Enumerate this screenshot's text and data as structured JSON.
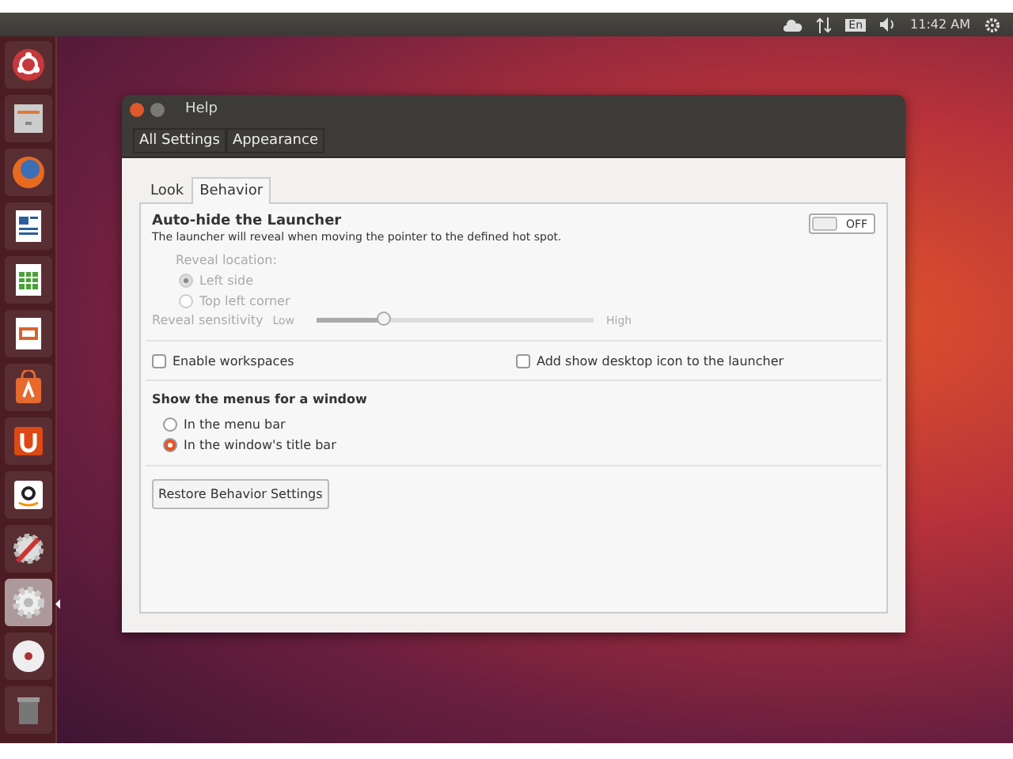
{
  "top_panel": {
    "keyboard": "En",
    "clock": "11:42 AM"
  },
  "launcher": [
    {
      "kind": "dash",
      "selected": false
    },
    {
      "kind": "files",
      "selected": false
    },
    {
      "kind": "browser",
      "selected": false
    },
    {
      "kind": "writer",
      "selected": false
    },
    {
      "kind": "calc",
      "selected": false
    },
    {
      "kind": "impress",
      "selected": false
    },
    {
      "kind": "store",
      "selected": false
    },
    {
      "kind": "ubuntu-one",
      "selected": false
    },
    {
      "kind": "amazon",
      "selected": false
    },
    {
      "kind": "tools",
      "selected": false
    },
    {
      "kind": "settings",
      "selected": true
    },
    {
      "kind": "disc",
      "selected": false
    },
    {
      "kind": "trash",
      "selected": false
    }
  ],
  "window": {
    "title": "Help",
    "toolbar": [
      "All Settings",
      "Appearance"
    ],
    "tabs": [
      {
        "label": "Look",
        "selected": false
      },
      {
        "label": "Behavior",
        "selected": true
      }
    ],
    "autohide": {
      "title": "Auto-hide the Launcher",
      "description": "The launcher will reveal when moving the pointer to the defined hot spot.",
      "switch": {
        "on": false,
        "label": "OFF"
      },
      "reveal_location": {
        "label": "Reveal location:",
        "disabled": true,
        "options": [
          {
            "label": "Left side",
            "selected": true
          },
          {
            "label": "Top left corner",
            "selected": false
          }
        ]
      },
      "sensitivity": {
        "label": "Reveal sensitivity",
        "low": "Low",
        "high": "High",
        "level": 0.24,
        "disabled": true
      }
    },
    "checkboxes": [
      {
        "label": "Enable workspaces",
        "checked": false
      },
      {
        "label": "Add show desktop icon to the launcher",
        "checked": false
      }
    ],
    "menus": {
      "title": "Show the menus for a window",
      "options": [
        {
          "label": "In the menu bar",
          "selected": false
        },
        {
          "label": "In the window's title bar",
          "selected": true
        }
      ]
    },
    "restore_button": "Restore Behavior Settings"
  }
}
